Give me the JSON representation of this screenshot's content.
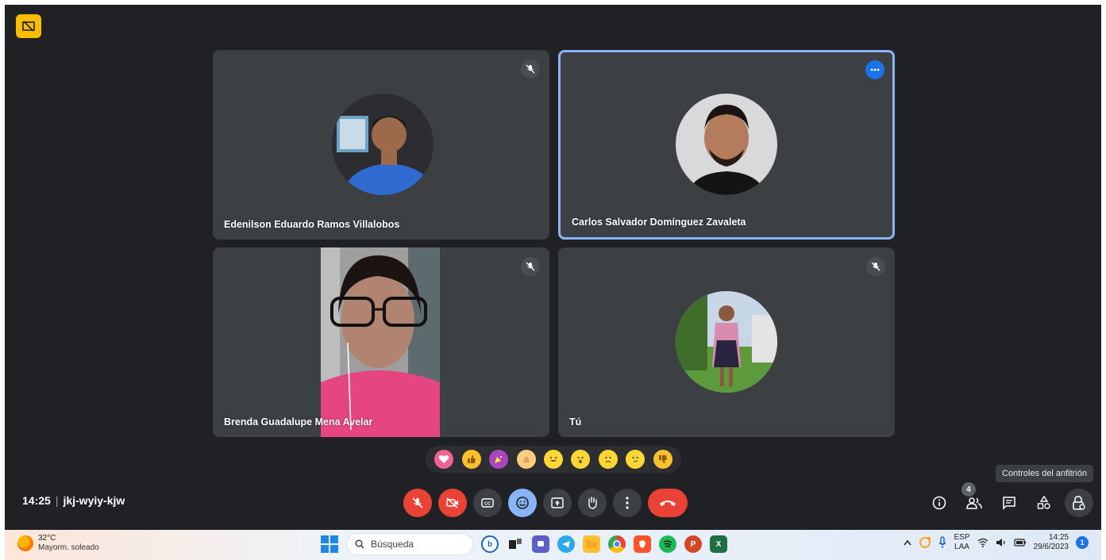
{
  "meeting": {
    "time": "14:25",
    "code": "jkj-wyiy-kjw"
  },
  "participants": [
    {
      "name": "Edenilson Eduardo Ramos Villalobos",
      "muted": true
    },
    {
      "name": "Carlos Salvador Domínguez Zavaleta",
      "active_speaker": true
    },
    {
      "name": "Brenda Guadalupe Mena Avelar",
      "muted": true,
      "video": true
    },
    {
      "name": "Tú",
      "muted": true
    }
  ],
  "reactions": [
    "sparkling-heart",
    "thumbs-up",
    "party-popper",
    "clapping-hands",
    "tears-of-joy",
    "astonished",
    "crying",
    "thinking",
    "thumbs-down"
  ],
  "controls": [
    "mic-off",
    "camera-off",
    "captions",
    "reactions",
    "present",
    "raise-hand",
    "more-options",
    "leave-call"
  ],
  "right_controls": {
    "tooltip": "Controles del anfitrión",
    "people_count": "4",
    "icons": [
      "info",
      "people",
      "chat",
      "activities",
      "host-controls"
    ]
  },
  "taskbar": {
    "temperature": "32°C",
    "weather_desc": "Mayorm. soleado",
    "search_placeholder": "Búsqueda",
    "lang_1": "ESP",
    "lang_2": "LAA",
    "clock_time": "14:25",
    "clock_date": "29/6/2023",
    "notification_count": "1"
  },
  "colors": {
    "background": "#202124",
    "tile": "#3c4043",
    "active_border": "#8ab4f8",
    "danger": "#ea4335",
    "accent": "#1a73e8"
  }
}
